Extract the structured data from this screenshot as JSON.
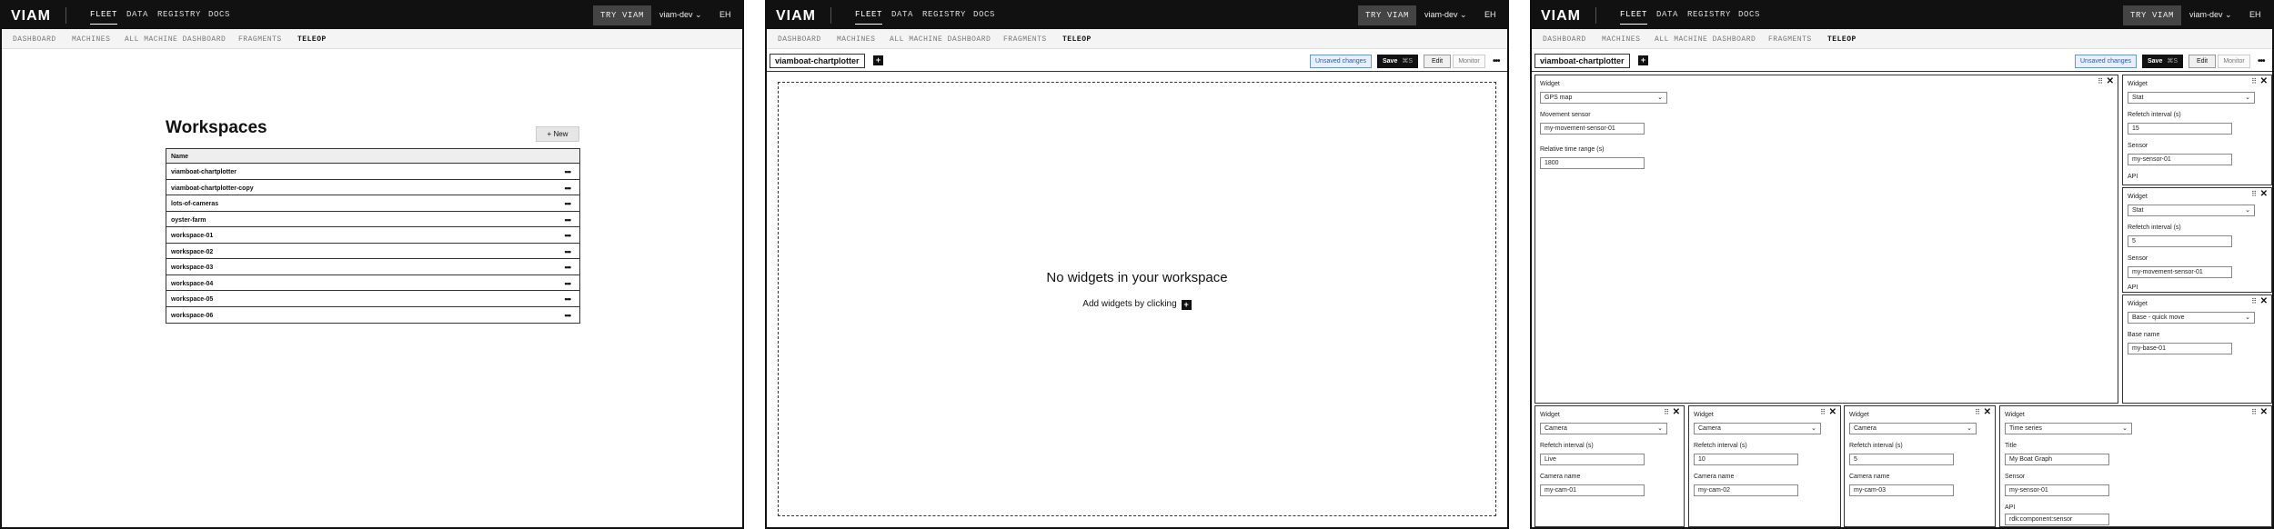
{
  "nav": {
    "logo": "VIAM",
    "links": [
      "FLEET",
      "DATA",
      "REGISTRY",
      "DOCS"
    ],
    "try_label": "TRY VIAM",
    "org": "viam-dev",
    "avatar": "EH"
  },
  "subnav": [
    "DASHBOARD",
    "MACHINES",
    "ALL MACHINE DASHBOARD",
    "FRAGMENTS",
    "TELEOP"
  ],
  "workspaces": {
    "title": "Workspaces",
    "new_label": "New",
    "column": "Name",
    "rows": [
      "viamboat-chartplotter",
      "viamboat-chartplotter-copy",
      "lots-of-cameras",
      "oyster-farm",
      "workspace-01",
      "workspace-02",
      "workspace-03",
      "workspace-04",
      "workspace-05",
      "workspace-06"
    ]
  },
  "editor": {
    "workspace_name": "viamboat-chartplotter",
    "unsaved": "Unsaved changes",
    "save": "Save",
    "save_key": "⌘S",
    "edit": "Edit",
    "monitor": "Monitor",
    "empty_title": "No widgets in your workspace",
    "empty_sub": "Add widgets by clicking"
  },
  "widgets": {
    "gps": {
      "label": "Widget",
      "type": "GPS map",
      "f1_label": "Movement sensor",
      "f1_value": "my-movement-sensor-01",
      "f2_label": "Relative time range (s)",
      "f2_value": "1800"
    },
    "stat1": {
      "label": "Widget",
      "type": "Stat",
      "f1_label": "Refetch interval (s)",
      "f1_value": "15",
      "f2_label": "Sensor",
      "f2_value": "my-sensor-01",
      "f3_label": "API"
    },
    "stat2": {
      "label": "Widget",
      "type": "Stat",
      "f1_label": "Refetch interval (s)",
      "f1_value": "5",
      "f2_label": "Sensor",
      "f2_value": "my-movement-sensor-01",
      "f3_label": "API"
    },
    "base": {
      "label": "Widget",
      "type": "Base - quick move",
      "f1_label": "Base name",
      "f1_value": "my-base-01"
    },
    "cam1": {
      "label": "Widget",
      "type": "Camera",
      "f1_label": "Refetch interval (s)",
      "f1_value": "Live",
      "f2_label": "Camera name",
      "f2_value": "my-cam-01"
    },
    "cam2": {
      "label": "Widget",
      "type": "Camera",
      "f1_label": "Refetch interval (s)",
      "f1_value": "10",
      "f2_label": "Camera name",
      "f2_value": "my-cam-02"
    },
    "cam3": {
      "label": "Widget",
      "type": "Camera",
      "f1_label": "Refetch interval (s)",
      "f1_value": "5",
      "f2_label": "Camera name",
      "f2_value": "my-cam-03"
    },
    "ts": {
      "label": "Widget",
      "type": "Time series",
      "f1_label": "Title",
      "f1_value": "My Boat Graph",
      "f2_label": "Sensor",
      "f2_value": "my-sensor-01",
      "f3_label": "API",
      "f3_value": "rdk:component:sensor"
    }
  }
}
